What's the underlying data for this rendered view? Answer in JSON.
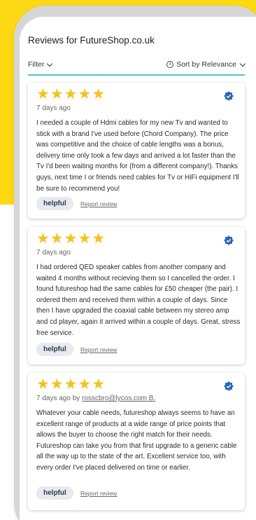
{
  "header": {
    "title": "Reviews for FutureShop.co.uk"
  },
  "toolbar": {
    "filter_label": "Filter",
    "sort_label": "Sort by Relevance"
  },
  "icons": {
    "verified": "verified-badge-icon",
    "info": "info-icon",
    "chevron": "chevron-down-icon",
    "star": "star-icon"
  },
  "colors": {
    "background_accent": "#fdd913",
    "star": "#f6c11b",
    "verified_badge": "#2a64b8",
    "filter_underline": "#52bfcf"
  },
  "reviews": [
    {
      "rating": 5,
      "date": "7 days ago",
      "author": "",
      "text": "I needed a couple of Hdmi cables for my new Tv and wanted to stick with a brand I've used before (Chord Company). The price was competitive and the choice of cable lengths was a bonus, delivery time only took a few days and arrived a lot faster than the Tv I'd been waiting months for (from a different company!). Thanks guys, next time I or friends need cables for Tv or HiFi equipment I'll be sure to recommend you!",
      "helpful_label": "helpful",
      "report_label": "Report review"
    },
    {
      "rating": 5,
      "date": "7 days ago",
      "author": "",
      "text": "I had ordered QED speaker cables from another company and waited 4 months without recieving them so I cancelled the order. I found futureshop had the same cables for £50 cheaper (the pair). I ordered them and received them within a couple of days. Since then I have upgraded the coaxial cable between my stereo amp and cd player, again it arrived within a couple of days. Great, stress free service.",
      "helpful_label": "helpful",
      "report_label": "Report review"
    },
    {
      "rating": 5,
      "date": "7 days ago by",
      "author": "rosscbro@lycos.com B.",
      "text": "Whatever your cable needs, futureshop always seems to have an excellent range of products at a wide range of price points that allows the buyer to choose the right match for their needs. Futureshop can take you from that first upgrade to a generic cable all the way up to the state of the art. Excellent service too, with every order I've placed delivered on time or earlier.",
      "helpful_label": "helpful",
      "report_label": "Report review"
    }
  ]
}
